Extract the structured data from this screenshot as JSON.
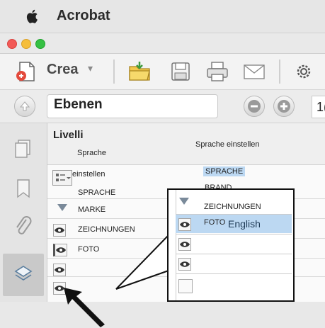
{
  "menubar": {
    "app_name": "Acrobat",
    "apple_icon": "apple-logo-icon"
  },
  "titlebar": {
    "traffic_lights": [
      "#f25a57",
      "#f5be3c",
      "#36c043"
    ]
  },
  "toolbar": {
    "create_label": "Crea",
    "icons": [
      "create-pdf-icon",
      "open-folder-icon",
      "save-icon",
      "print-icon",
      "email-icon",
      "settings-icon"
    ]
  },
  "toolbar2": {
    "title": "Ebenen",
    "page_number": "1("
  },
  "panel": {
    "header": "Livelli",
    "col_left": "Sprache",
    "col_right": "Sprache einstellen",
    "rows": [
      {
        "left": "einstellen",
        "right": "SPRACHE"
      },
      {
        "left": "SPRACHE",
        "right": "BRAND"
      },
      {
        "left": "MARKE",
        "right": ""
      },
      {
        "left": "ZEICHNUNGEN",
        "right": ""
      },
      {
        "left": "FOTO",
        "right": ""
      }
    ]
  },
  "popup": {
    "rows": [
      {
        "label": "ZEICHNUNGEN"
      },
      {
        "label": "FOTO",
        "overlay": "English"
      },
      {
        "label": ""
      },
      {
        "label": ""
      },
      {
        "label": ""
      }
    ]
  },
  "colors": {
    "accent": "#bcd8f2"
  }
}
